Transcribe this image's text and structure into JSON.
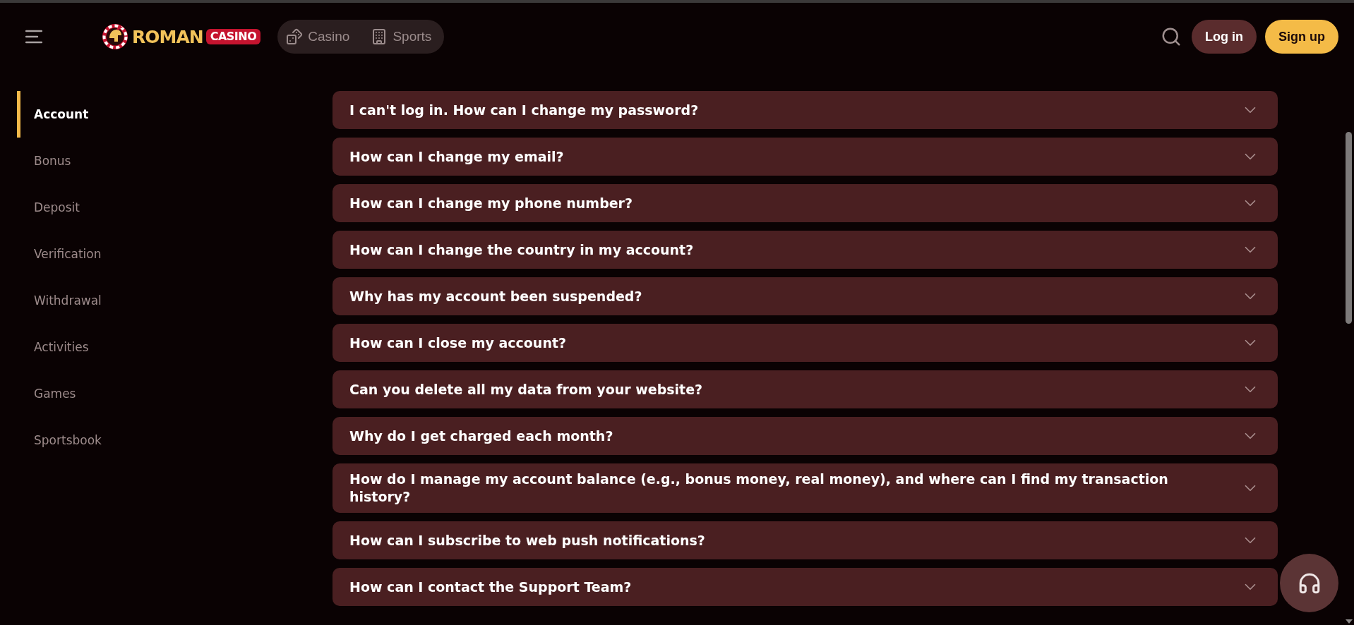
{
  "header": {
    "logo": {
      "word": "ROMAN",
      "badge": "CASINO"
    },
    "nav": [
      {
        "label": "Casino",
        "kind": "dice"
      },
      {
        "label": "Sports",
        "kind": "building"
      }
    ],
    "buttons": [
      {
        "label": "Log in",
        "kind": "secondary"
      },
      {
        "label": "Sign up",
        "kind": "primary"
      }
    ]
  },
  "sidebar": {
    "items": [
      {
        "label": "Account",
        "selected": true
      },
      {
        "label": "Bonus",
        "selected": false
      },
      {
        "label": "Deposit",
        "selected": false
      },
      {
        "label": "Verification",
        "selected": false
      },
      {
        "label": "Withdrawal",
        "selected": false
      },
      {
        "label": "Activities",
        "selected": false
      },
      {
        "label": "Games",
        "selected": false
      },
      {
        "label": "Sportsbook",
        "selected": false
      }
    ]
  },
  "faq": {
    "items": [
      {
        "question": "I can't log in. How can I change my password?",
        "expanded": false
      },
      {
        "question": "How can I change my email?",
        "expanded": false
      },
      {
        "question": "How can I change my phone number?",
        "expanded": false
      },
      {
        "question": "How can I change the country in my account?",
        "expanded": false
      },
      {
        "question": "Why has my account been suspended?",
        "expanded": false
      },
      {
        "question": "How can I close my account?",
        "expanded": false
      },
      {
        "question": "Can you delete all my data from your website?",
        "expanded": false
      },
      {
        "question": "Why do I get charged each month?",
        "expanded": false
      },
      {
        "question": "How do I manage my account balance (e.g., bonus money, real money), and where can I find my transaction history?",
        "expanded": false
      },
      {
        "question": "How can I subscribe to web push notifications?",
        "expanded": false
      },
      {
        "question": "How can I contact the Support Team?",
        "expanded": false
      }
    ]
  }
}
